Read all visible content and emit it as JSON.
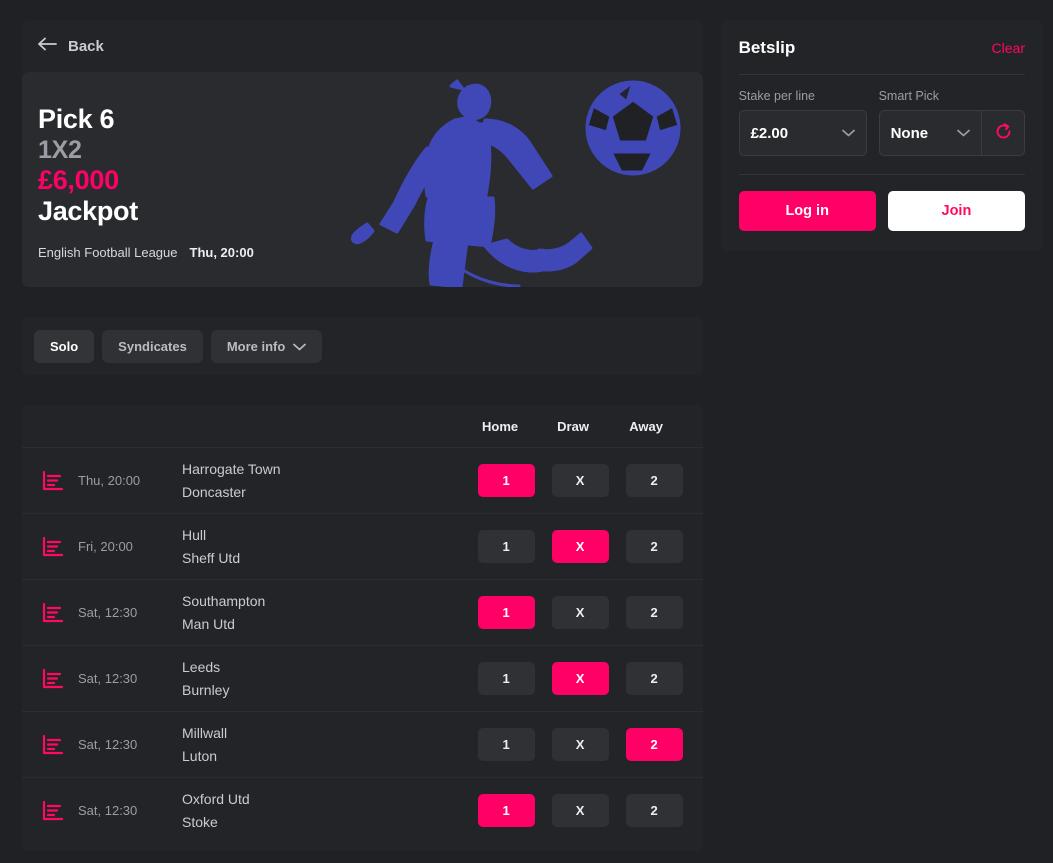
{
  "nav": {
    "back_label": "Back",
    "back_icon": "arrow-left-icon"
  },
  "hero": {
    "title": "Pick 6",
    "subtitle": "1X2",
    "amount": "£6,000",
    "jackpot_label": "Jackpot",
    "league": "English Football League",
    "kickoff": "Thu, 20:00",
    "art": "football-player-line-art",
    "accent_color": "#ff0066",
    "art_color": "#4048b8"
  },
  "tabs": [
    {
      "label": "Solo",
      "active": true
    },
    {
      "label": "Syndicates",
      "active": false
    },
    {
      "label": "More info",
      "active": false,
      "icon": "chevron-down-icon"
    }
  ],
  "table": {
    "headers": [
      "Home",
      "Draw",
      "Away"
    ],
    "stats_icon": "stats-bar-icon",
    "rows": [
      {
        "time": "Thu, 20:00",
        "home_team": "Harrogate Town",
        "away_team": "Doncaster",
        "options": [
          "1",
          "X",
          "2"
        ],
        "selected": 0
      },
      {
        "time": "Fri, 20:00",
        "home_team": "Hull",
        "away_team": "Sheff Utd",
        "options": [
          "1",
          "X",
          "2"
        ],
        "selected": 1
      },
      {
        "time": "Sat, 12:30",
        "home_team": "Southampton",
        "away_team": "Man Utd",
        "options": [
          "1",
          "X",
          "2"
        ],
        "selected": 0
      },
      {
        "time": "Sat, 12:30",
        "home_team": "Leeds",
        "away_team": "Burnley",
        "options": [
          "1",
          "X",
          "2"
        ],
        "selected": 1
      },
      {
        "time": "Sat, 12:30",
        "home_team": "Millwall",
        "away_team": "Luton",
        "options": [
          "1",
          "X",
          "2"
        ],
        "selected": 2
      },
      {
        "time": "Sat, 12:30",
        "home_team": "Oxford Utd",
        "away_team": "Stoke",
        "options": [
          "1",
          "X",
          "2"
        ],
        "selected": 0
      }
    ]
  },
  "betslip": {
    "title": "Betslip",
    "clear_label": "Clear",
    "stake": {
      "label": "Stake per line",
      "value": "£2.00",
      "icon": "chevron-down-icon"
    },
    "smart_pick": {
      "label": "Smart Pick",
      "value": "None",
      "icon": "chevron-down-icon",
      "refresh_icon": "refresh-icon"
    },
    "login_label": "Log in",
    "join_label": "Join"
  }
}
